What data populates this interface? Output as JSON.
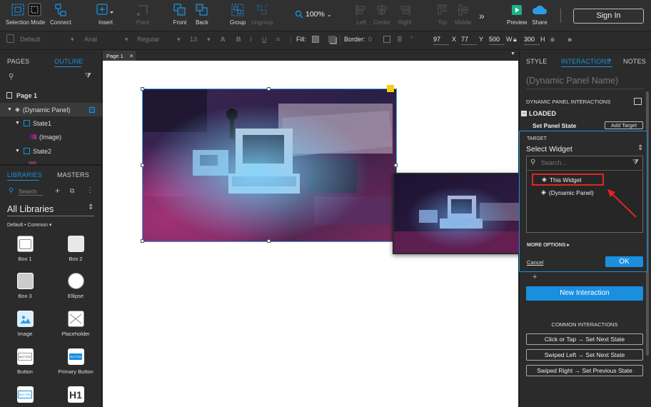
{
  "toolbar": {
    "selection_mode": "Selection Mode",
    "connect": "Connect",
    "insert": "Insert",
    "point": "Point",
    "front": "Front",
    "back": "Back",
    "group": "Group",
    "ungroup": "Ungroup",
    "zoom": "100%",
    "left": "Left",
    "center": "Center",
    "right": "Right",
    "top": "Top",
    "middle": "Middle",
    "preview": "Preview",
    "share": "Share",
    "sign_in": "Sign In"
  },
  "format_bar": {
    "style": "Default",
    "font": "Arial",
    "weight": "Regular",
    "size": "13",
    "bold": "B",
    "italic": "I",
    "underline": "U",
    "fill_label": "Fill:",
    "border_label": "Border:",
    "border_value": "0",
    "x": "97",
    "x_label": "X",
    "y": "77",
    "y_label": "Y",
    "w": "500",
    "w_label": "W",
    "h": "300",
    "h_label": "H"
  },
  "left_panel": {
    "tab_pages": "PAGES",
    "tab_outline": "OUTLINE",
    "outline": {
      "page": "Page 1",
      "dynamic_panel": "(Dynamic Panel)",
      "state1": "State1",
      "image": "(Image)",
      "state2": "State2"
    },
    "tab_libraries": "LIBRARIES",
    "tab_masters": "MASTERS",
    "search_placeholder": "Search",
    "library_select": "All Libraries",
    "library_subset": "Default • Common",
    "widgets": [
      "Box 1",
      "Box 2",
      "Box 3",
      "Ellipse",
      "Image",
      "Placeholder",
      "Button",
      "Primary Button",
      "",
      "H1"
    ],
    "widget_button_text": "BUTTON",
    "widget_h1_text": "H1"
  },
  "canvas": {
    "page_tab": "Page 1",
    "lightning": "⚡"
  },
  "right_panel": {
    "tab_style": "STYLE",
    "tab_interactions": "INTERACTIONS",
    "tab_notes": "NOTES",
    "panel_name_placeholder": "(Dynamic Panel Name)",
    "section_title": "DYNAMIC PANEL INTERACTIONS",
    "event": "LOADED",
    "action": "Set Panel State",
    "add_target": "Add Target",
    "target_label": "TARGET",
    "select_widget": "Select Widget",
    "search_placeholder": "Search...",
    "options": [
      "This Widget",
      "(Dynamic Panel)"
    ],
    "more_options": "MORE OPTIONS",
    "cancel": "Cancel",
    "ok": "OK",
    "plus": "+",
    "new_interaction": "New Interaction",
    "common_title": "COMMON INTERACTIONS",
    "common": [
      "Click or Tap → Set Next State",
      "Swiped Left → Set Next State",
      "Swiped Right → Set Previous State"
    ]
  },
  "colors": {
    "accent": "#1a8fe0",
    "highlight": "#e0271f",
    "toolbar_bg": "#2f2f2f",
    "panel_bg": "#2b2b2b"
  }
}
